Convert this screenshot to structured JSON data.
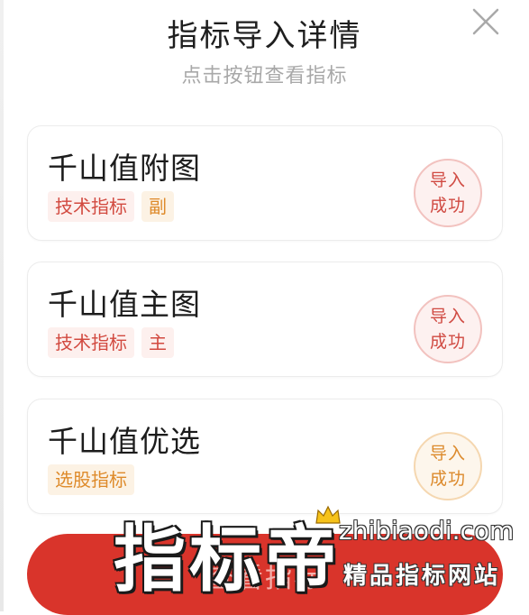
{
  "header": {
    "title": "指标导入详情",
    "subtitle": "点击按钮查看指标"
  },
  "icons": {
    "close": "close-icon",
    "crown": "crown-icon"
  },
  "indicators": [
    {
      "name": "千山值附图",
      "tags": [
        "技术指标",
        "副"
      ],
      "status_line1": "导入",
      "status_line2": "成功"
    },
    {
      "name": "千山值主图",
      "tags": [
        "技术指标",
        "主"
      ],
      "status_line1": "导入",
      "status_line2": "成功"
    },
    {
      "name": "千山值优选",
      "tags": [
        "选股指标"
      ],
      "status_line1": "导入",
      "status_line2": "成功"
    }
  ],
  "footer": {
    "button_label": "查看指标"
  },
  "watermark": {
    "main": "指标帝",
    "url": "zhibiaodi.com",
    "sub": "精品指标网站"
  },
  "colors": {
    "accent_red": "#d9342b",
    "tag_red": "#d24a40",
    "tag_orange": "#de8a2a"
  }
}
